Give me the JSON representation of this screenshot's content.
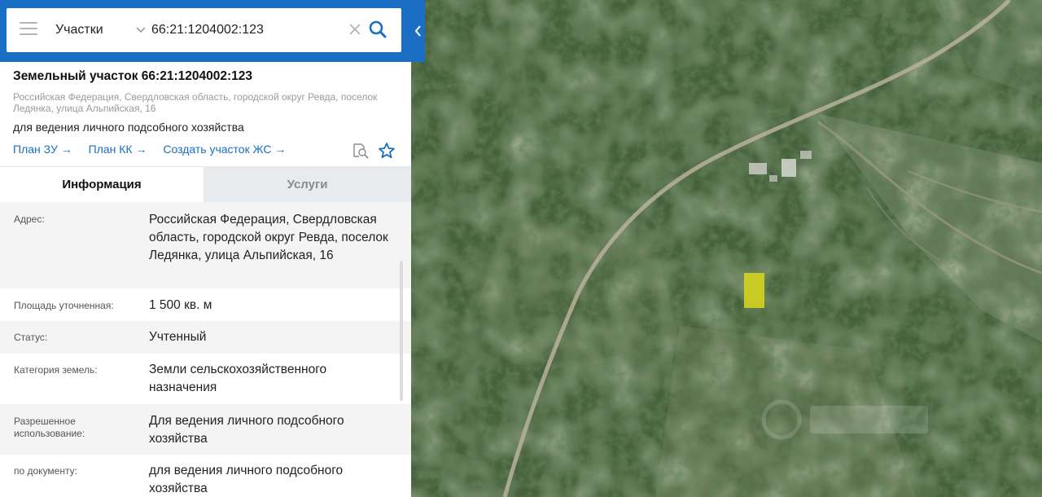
{
  "search": {
    "type_label": "Участки",
    "query": "66:21:1204002:123"
  },
  "parcel": {
    "title": "Земельный участок 66:21:1204002:123",
    "address_line": "Российская Федерация, Свердловская область, городской округ Ревда, поселок Ледянка, улица Альпийская, 16",
    "purpose": "для ведения личного подсобного хозяйства"
  },
  "links": [
    {
      "label": "План ЗУ →"
    },
    {
      "label": "План КК →"
    },
    {
      "label": "Создать участок ЖС →"
    }
  ],
  "icons": {
    "menu": "hamburger-menu-icon",
    "chevron": "chevron-down-icon",
    "clear": "close-icon",
    "search": "search-icon",
    "collapse": "chevron-left-icon",
    "find_on_map": "document-search-icon",
    "favorite": "star-icon"
  },
  "tabs": {
    "info": "Информация",
    "services": "Услуги"
  },
  "info_rows": [
    {
      "label": "Адрес:",
      "value": "Российская Федерация, Свердловская область, городской округ Ревда, поселок Ледянка, улица Альпийская, 16"
    },
    {
      "label": "Площадь уточненная:",
      "value": "1 500 кв. м"
    },
    {
      "label": "Статус:",
      "value": "Учтенный"
    },
    {
      "label": "Категория земель:",
      "value": "Земли сельскохозяйственного назначения"
    },
    {
      "label": "Разрешенное использование:",
      "value": "Для ведения личного подсобного хозяйства"
    },
    {
      "label": "по документу:",
      "value": "для ведения личного подсобного хозяйства"
    }
  ],
  "colors": {
    "header_blue": "#1a6fc4",
    "link_blue": "#1a6fc4",
    "parcel_highlight": "#d8d81a",
    "forest": "#3f5a38"
  }
}
